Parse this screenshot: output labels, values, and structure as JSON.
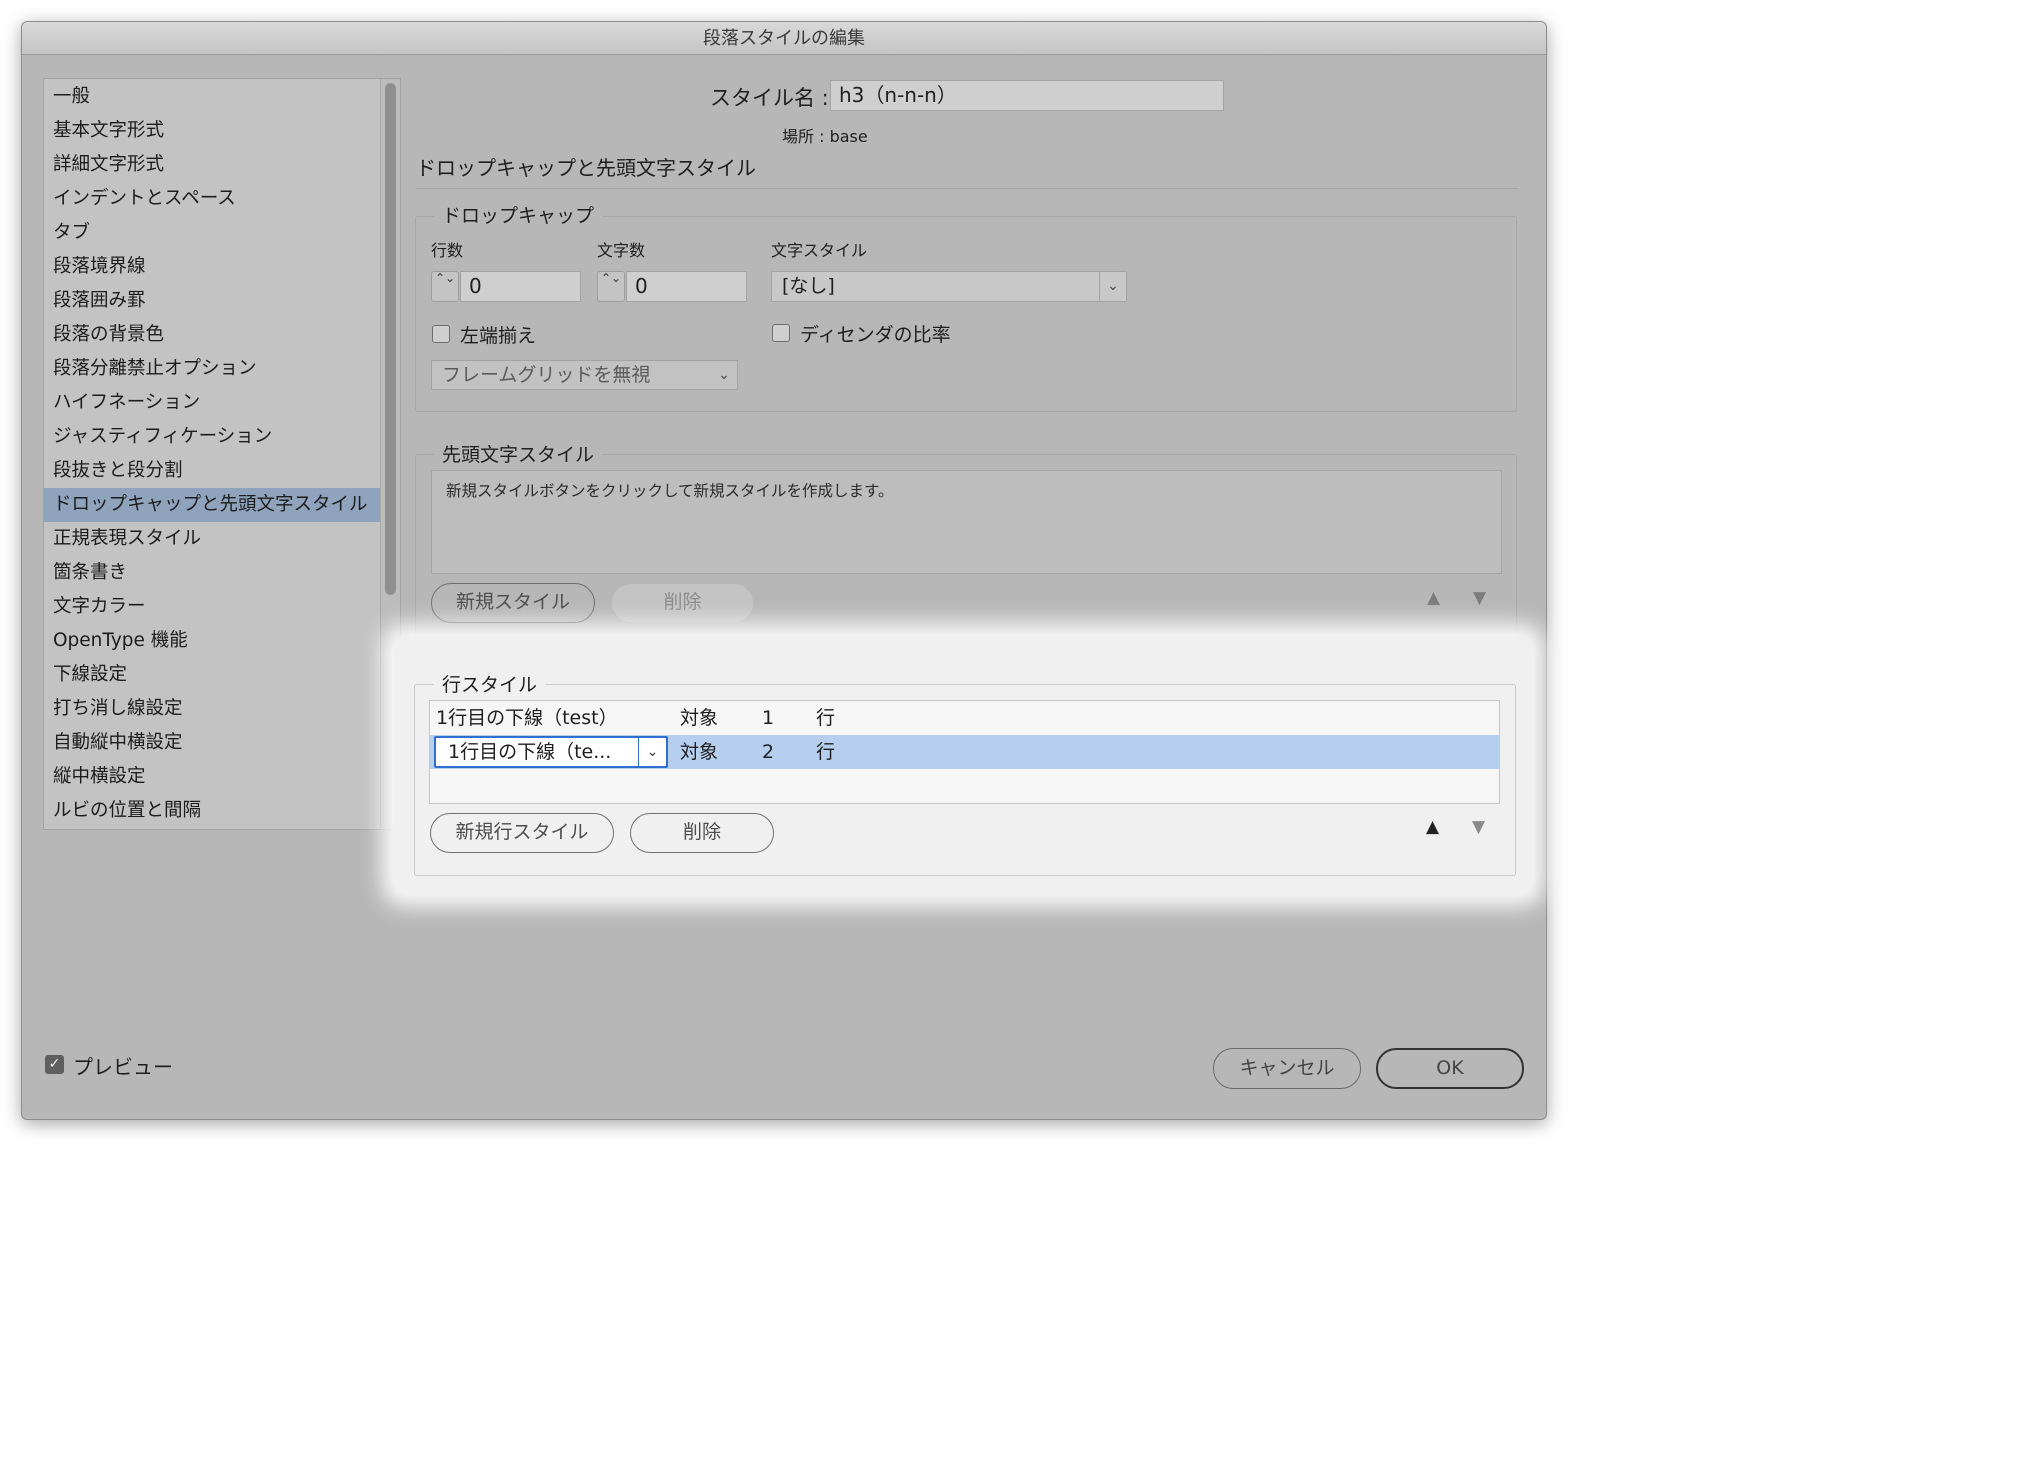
{
  "window": {
    "title": "段落スタイルの編集"
  },
  "sidebar": {
    "items": [
      {
        "label": "一般"
      },
      {
        "label": "基本文字形式"
      },
      {
        "label": "詳細文字形式"
      },
      {
        "label": "インデントとスペース"
      },
      {
        "label": "タブ"
      },
      {
        "label": "段落境界線"
      },
      {
        "label": "段落囲み罫"
      },
      {
        "label": "段落の背景色"
      },
      {
        "label": "段落分離禁止オプション"
      },
      {
        "label": "ハイフネーション"
      },
      {
        "label": "ジャスティフィケーション"
      },
      {
        "label": "段抜きと段分割"
      },
      {
        "label": "ドロップキャップと先頭文字スタイル"
      },
      {
        "label": "正規表現スタイル"
      },
      {
        "label": "箇条書き"
      },
      {
        "label": "文字カラー"
      },
      {
        "label": "OpenType 機能"
      },
      {
        "label": "下線設定"
      },
      {
        "label": "打ち消し線設定"
      },
      {
        "label": "自動縦中横設定"
      },
      {
        "label": "縦中横設定"
      },
      {
        "label": "ルビの位置と間隔"
      }
    ],
    "selected_label": "ドロップキャップと先頭文字スタイル"
  },
  "header": {
    "style_name_label": "スタイル名 :",
    "style_name_value": "h3（n-n-n）",
    "location_label": "場所 :",
    "location_value": "base",
    "section_title": "ドロップキャップと先頭文字スタイル"
  },
  "drop_cap": {
    "legend": "ドロップキャップ",
    "lines_label": "行数",
    "lines_value": "0",
    "chars_label": "文字数",
    "chars_value": "0",
    "char_style_label": "文字スタイル",
    "char_style_value": "[なし]",
    "align_left_label": "左端揃え",
    "align_left_checked": false,
    "descender_label": "ディセンダの比率",
    "descender_checked": false,
    "frame_grid_value": "フレームグリッドを無視"
  },
  "nested_styles": {
    "legend": "先頭文字スタイル",
    "hint": "新規スタイルボタンをクリックして新規スタイルを作成します。",
    "new_button": "新規スタイル",
    "delete_button": "削除"
  },
  "line_styles": {
    "legend": "行スタイル",
    "rows": [
      {
        "style": "1行目の下線（test）",
        "target": "対象",
        "count": "1",
        "unit": "行"
      },
      {
        "style": "1行目の下線（te...",
        "target": "対象",
        "count": "2",
        "unit": "行"
      }
    ],
    "new_button": "新規行スタイル",
    "delete_button": "削除"
  },
  "footer": {
    "preview_label": "プレビュー",
    "preview_checked": true,
    "cancel_button": "キャンセル",
    "ok_button": "OK"
  },
  "glyphs": {
    "up_down": "⌃⌄",
    "chevron": "⌄",
    "up_arrow": "▲",
    "down_arrow": "▼",
    "check": "✓"
  },
  "colors": {
    "dialog_bg": "#b7b7b7",
    "sidebar_selected": "#8fa3bd",
    "row_selected": "#b6cfee",
    "focus_ring": "#2f6fd0"
  }
}
